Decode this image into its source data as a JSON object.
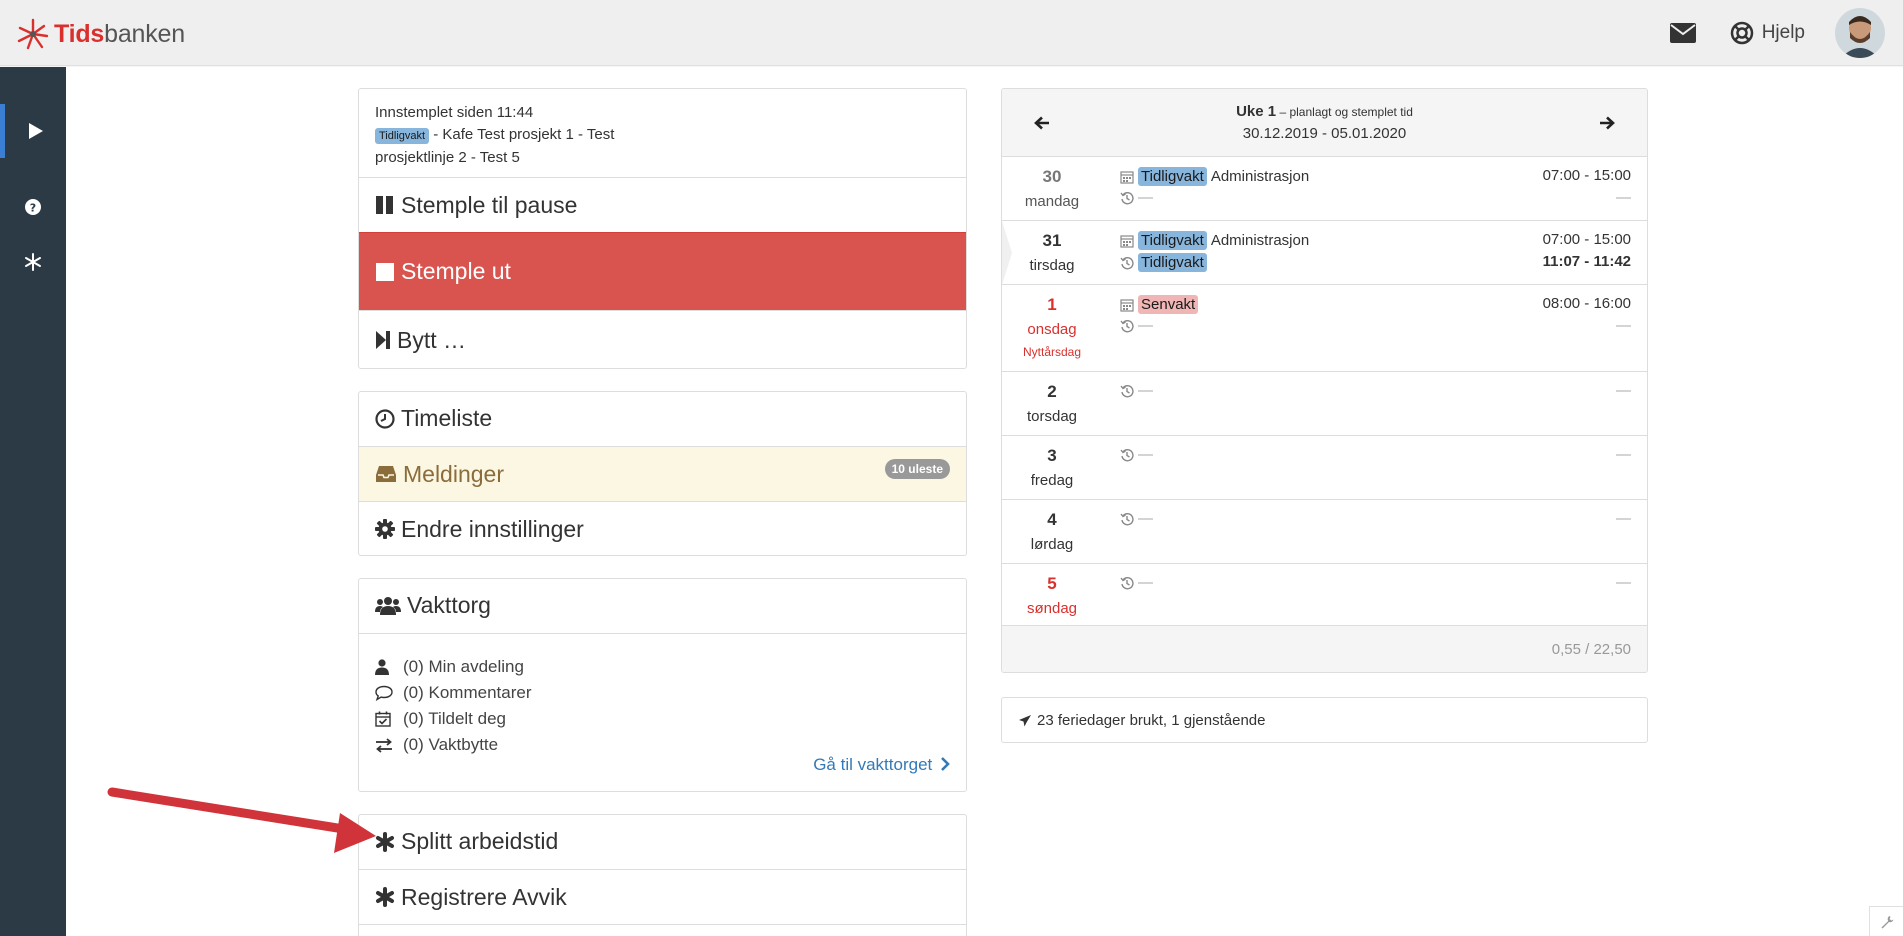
{
  "brand": {
    "tids": "Tids",
    "banken": "banken"
  },
  "header": {
    "help_label": "Hjelp"
  },
  "clock": {
    "since_text": "Innstemplet siden 11:44",
    "shift_label": "Tidligvakt",
    "project_line1": " - Kafe Test prosjekt 1 - Test",
    "project_line2": "prosjektlinje 2 - Test 5",
    "pause_label": "Stemple til pause",
    "out_label": "Stemple ut",
    "switch_label": "Bytt …"
  },
  "menu": {
    "timeliste": "Timeliste",
    "meldinger": "Meldinger",
    "unread_badge": "10 uleste",
    "settings": "Endre innstillinger"
  },
  "vakttorg": {
    "title": "Vakttorg",
    "items": [
      {
        "icon": "user-icon",
        "label": "(0) Min avdeling"
      },
      {
        "icon": "comment-icon",
        "label": "(0) Kommentarer"
      },
      {
        "icon": "calendar-check-icon",
        "label": "(0) Tildelt deg"
      },
      {
        "icon": "exchange-icon",
        "label": "(0) Vaktbytte"
      }
    ],
    "goto_label": "Gå til vakttorget"
  },
  "extra": {
    "split": "Splitt arbeidstid",
    "avvik": "Registrere Avvik"
  },
  "week": {
    "title_bold": "Uke 1",
    "title_rest": " – planlagt og stemplet tid",
    "dates": "30.12.2019 - 05.01.2020",
    "days": [
      {
        "num": "30",
        "name": "mandag",
        "plan_label": "Tidligvakt",
        "plan_text": "Administrasjon",
        "plan_time": "07:00 - 15:00",
        "stamp_label": "",
        "stamp_text": "—",
        "stamp_time": "—"
      },
      {
        "num": "31",
        "name": "tirsdag",
        "plan_label": "Tidligvakt",
        "plan_text": "Administrasjon",
        "plan_time": "07:00 - 15:00",
        "stamp_label": "Tidligvakt",
        "stamp_text": "",
        "stamp_time": "11:07 - 11:42"
      },
      {
        "num": "1",
        "name": "onsdag",
        "holiday": "Nyttårsdag",
        "plan_label": "Senvakt",
        "plan_text": "",
        "plan_time": "08:00 - 16:00",
        "stamp_label": "",
        "stamp_text": "—",
        "stamp_time": "—"
      },
      {
        "num": "2",
        "name": "torsdag",
        "stamp_text": "—",
        "stamp_time": "—"
      },
      {
        "num": "3",
        "name": "fredag",
        "stamp_text": "—",
        "stamp_time": "—"
      },
      {
        "num": "4",
        "name": "lørdag",
        "stamp_text": "—",
        "stamp_time": "—"
      },
      {
        "num": "5",
        "name": "søndag",
        "stamp_text": "—",
        "stamp_time": "—"
      }
    ],
    "total": "0,55 / 22,50"
  },
  "holidays": {
    "text": "23 feriedager brukt, 1 gjenstående"
  },
  "colors": {
    "stamp_out": "#d9534f",
    "sidebar": "#2c3a46",
    "brand_red": "#d9302d",
    "link": "#337ab7",
    "arrow": "#d0343a"
  }
}
